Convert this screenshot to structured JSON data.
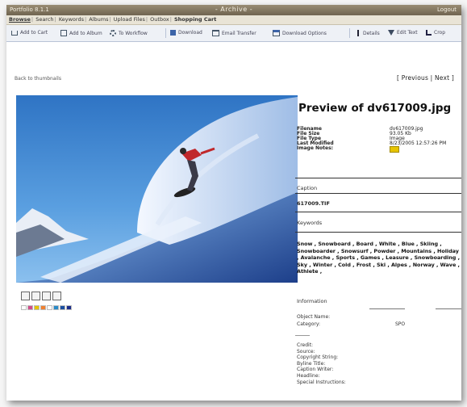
{
  "window": {
    "app_name": "Portfolio 8.1.1",
    "title": "- Archive -",
    "logout_label": "Logout"
  },
  "nav": {
    "items": [
      "Browse",
      "Search",
      "Keywords",
      "Albums",
      "Upload Files",
      "Outbox",
      "Shopping Cart"
    ]
  },
  "toolbar": {
    "add_to_cart": "Add to Cart",
    "add_to_album": "Add to Album",
    "to_workflow": "To Workflow",
    "download": "Download",
    "email_transfer": "Email Transfer",
    "download_options": "Download Options",
    "details": "Details",
    "edit_text": "Edit Text",
    "crop": "Crop"
  },
  "back_link": "Back to thumbnails",
  "pager": {
    "open": "[",
    "previous": "Previous",
    "divider": "|",
    "next": "Next",
    "close": "]"
  },
  "preview": {
    "title": "Preview of dv617009.jpg",
    "metadata": [
      {
        "key": "Filename",
        "value": "dv617009.jpg"
      },
      {
        "key": "File Size",
        "value": "93.05 Kb"
      },
      {
        "key": "File Type",
        "value": "Image"
      },
      {
        "key": "Last Modified",
        "value": "8/23/2005 12:57:26 PM"
      },
      {
        "key": "Image Notes:",
        "value": ""
      }
    ],
    "note_icon": "sticky-note-icon",
    "caption_label": "Caption",
    "caption_value": "617009.TIF",
    "keywords_label": "Keywords",
    "keywords_text": "Snow , Snowboard , Board , White , Blue , Skiing , Snowboarder , Snowsurf , Powder , Mountains , Holiday , Avalanche , Sports , Games , Leasure , Snowboarding , Sky , Winter , Cold , Frost , Ski , Alpes , Norway , Wave , Athlete ,",
    "information_label": "Information",
    "object_name_label": "Object Name:",
    "category_label": "Category:",
    "category_value": "SPO",
    "fields": [
      "Credit:",
      "Source:",
      "Copyright String:",
      "Byline Title:",
      "Caption Writer:",
      "Headline:",
      "Special Instructions:"
    ]
  },
  "colors": {
    "title_bar": "#7e7259",
    "nav_bar": "#e9e4d6",
    "toolbar": "#eef1f6",
    "accent_blue": "#3c64a8",
    "note_yellow": "#e6c400"
  },
  "swatch_colors": [
    "#ffffff",
    "#d24c8a",
    "#e6c400",
    "#f08030",
    "#ffffff",
    "#2a8ac8",
    "#1a4fa0",
    "#1b2d8a"
  ]
}
